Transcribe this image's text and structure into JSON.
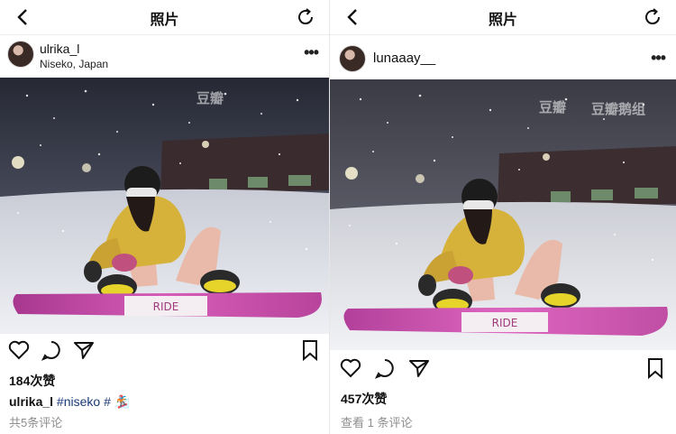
{
  "left_post": {
    "nav": {
      "title": "照片"
    },
    "user": {
      "username": "ulrika_l",
      "location": "Niseko, Japan"
    },
    "more_label": "•••",
    "watermark_logo": "豆瓣",
    "likes": "184次赞",
    "caption": {
      "username": "ulrika_l",
      "hashtag": "#niseko",
      "extra": "#"
    },
    "comments": "共5条评论"
  },
  "right_post": {
    "nav": {
      "title": "照片"
    },
    "user": {
      "username": "lunaaay__"
    },
    "more_label": "•••",
    "watermark_logo": "豆瓣",
    "watermark_text": "豆瓣鹅组",
    "likes": "457次赞",
    "comments": "查看 1 条评论"
  },
  "icons": [
    "back-icon",
    "refresh-icon",
    "heart-icon",
    "comment-icon",
    "share-icon",
    "bookmark-icon"
  ],
  "colors": {
    "board": "#c84aa6",
    "jacket": "#d6b23a",
    "snow_bg": "#d8dbe2",
    "night_sky": "#2a2d3a"
  }
}
